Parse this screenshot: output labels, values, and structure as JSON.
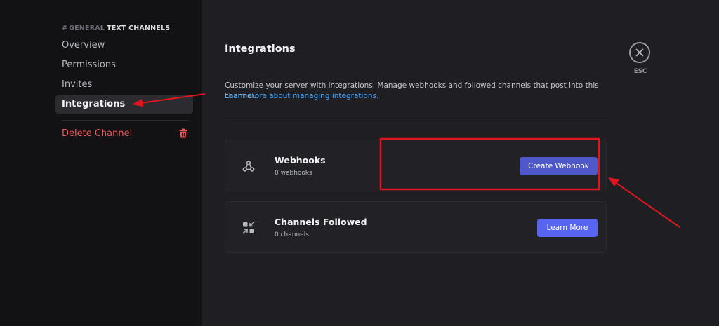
{
  "sidebar": {
    "header": {
      "hash": "#",
      "channel": "GENERAL",
      "section": "TEXT CHANNELS"
    },
    "items": [
      {
        "label": "Overview"
      },
      {
        "label": "Permissions"
      },
      {
        "label": "Invites"
      },
      {
        "label": "Integrations"
      }
    ],
    "delete_label": "Delete Channel"
  },
  "main": {
    "title": "Integrations",
    "description": "Customize your server with integrations. Manage webhooks and followed channels that post into this channel.",
    "learn_more_link": "Learn more about managing integrations.",
    "cards": [
      {
        "title": "Webhooks",
        "subtitle": "0 webhooks",
        "button": "Create Webhook",
        "icon": "webhook-icon"
      },
      {
        "title": "Channels Followed",
        "subtitle": "0 channels",
        "button": "Learn More",
        "icon": "channels-followed-icon"
      }
    ]
  },
  "close": {
    "label": "ESC"
  },
  "colors": {
    "sidebar_bg": "#121214",
    "main_bg": "#1f1f23",
    "accent": "#5865f2",
    "danger": "#f0575b",
    "link": "#3ea6ff",
    "annotation": "#e0161e"
  }
}
